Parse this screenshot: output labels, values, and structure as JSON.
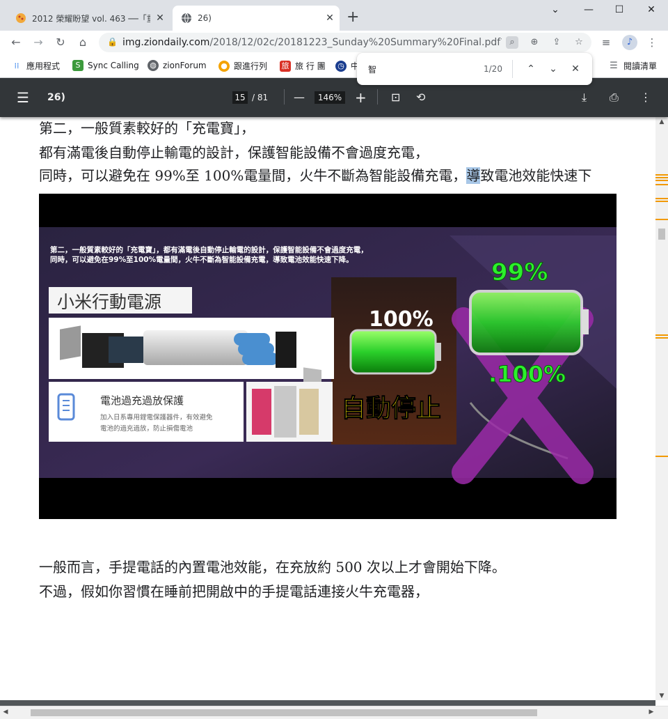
{
  "tabs": [
    {
      "title": "2012 榮耀盼望 vol. 463 ──「重",
      "close": "✕"
    },
    {
      "title": "26)",
      "close": "✕"
    }
  ],
  "window_controls": {
    "chevron": "⌄",
    "minimize": "—",
    "maximize": "☐",
    "close": "✕"
  },
  "new_tab": "+",
  "address": {
    "host": "img.ziondaily.com",
    "path": "/2018/12/02c/20181223_Sunday%20Summary%20Final.pdf?1..."
  },
  "bookmarks": [
    {
      "label": "應用程式",
      "color": "#1a73e8"
    },
    {
      "label": "Sync Calling",
      "color": "#3c9a3c"
    },
    {
      "label": "zionForum",
      "color": "#5f6368"
    },
    {
      "label": "跟進行列",
      "color": "#f4a300"
    },
    {
      "label": "旅 行 團",
      "color": "#d93025"
    },
    {
      "label": "中",
      "color": "#1a3d8f"
    }
  ],
  "reading_list": "閱讀清單",
  "find": {
    "query": "智",
    "count": "1/20"
  },
  "pdf": {
    "title": "26)",
    "page_current": "15",
    "page_total": "/ 81",
    "zoom": "146%"
  },
  "content": {
    "line1": "第二，一般質素較好的「充電寶」，",
    "line2": "都有滿電後自動停止輸電的設計，保護智能設備不會過度充電，",
    "line3_a": "同時，可以避免在 99%至 100%電量間，火牛不斷為智能設備充電，",
    "line3_hl": "導",
    "line3_b": "致電池效能快速下",
    "line4": "一般而言，手提電話的內置電池效能，在充放約 500 次以上才會開始下降。",
    "line5": "不過，假如你習慣在睡前把開啟中的手提電話連接火牛充電器，"
  },
  "image": {
    "caption1": "第二，一般質素較好的「充電寶」，都有滿電後自動停止輸電的設計，保護智能設備不會過度充電，",
    "caption2": "同時，可以避免在99%至100%電量間，火牛不斷為智能設備充電，導致電池效能快速下降。",
    "product_title": "小米行動電源",
    "protect_title": "電池過充過放保護",
    "protect_desc1": "加入日系專用鋰電保護器件，有效避免",
    "protect_desc2": "電池的過充過放，防止損傷電池",
    "pct_full": "100%",
    "auto_stop": "自動停止",
    "pct_99": "99%",
    "pct_100b": ".100%"
  }
}
